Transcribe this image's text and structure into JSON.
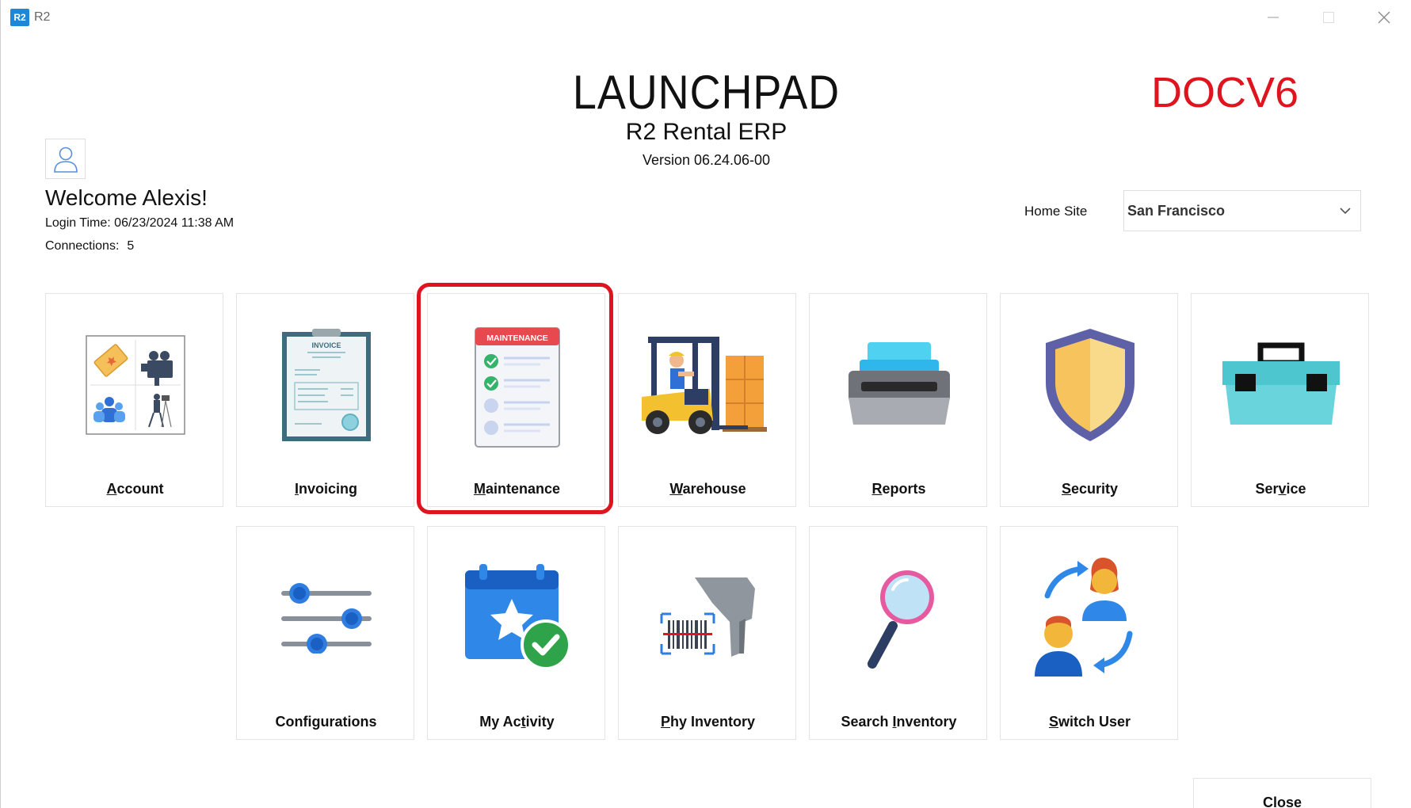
{
  "window": {
    "badge": "R2",
    "title": "R2"
  },
  "header": {
    "title": "LAUNCHPAD",
    "product": "R2 Rental ERP",
    "version": "Version 06.24.06-00",
    "environment": "DOCV6",
    "environment_color": "#e0141e"
  },
  "user": {
    "welcome": "Welcome Alexis!",
    "login_time_label": "Login Time:",
    "login_time": "06/23/2024 11:38 AM",
    "connections_label": "Connections:",
    "connections": "5"
  },
  "home_site": {
    "label": "Home Site",
    "value": "San Francisco"
  },
  "tiles_row1": [
    {
      "label": "Account",
      "accel": "A",
      "rest": "ccount",
      "icon": "account-icon"
    },
    {
      "label": "Invoicing",
      "accel": "I",
      "rest": "nvoicing",
      "icon": "invoice-icon"
    },
    {
      "label": "Maintenance",
      "accel": "M",
      "rest": "aintenance",
      "icon": "maintenance-checklist-icon",
      "badge": "MAINTENANCE"
    },
    {
      "label": "Warehouse",
      "accel": "W",
      "rest": "arehouse",
      "icon": "forklift-icon"
    },
    {
      "label": "Reports",
      "accel": "R",
      "rest": "eports",
      "icon": "printer-icon"
    },
    {
      "label": "Security",
      "accel": "S",
      "rest": "ecurity",
      "icon": "shield-icon"
    },
    {
      "label": "Service",
      "pre": "Ser",
      "accel": "v",
      "rest": "ice",
      "icon": "toolbox-icon"
    }
  ],
  "tiles_row2": [
    {
      "label": "Configurations",
      "icon": "sliders-icon"
    },
    {
      "label": "My Activity",
      "pre": "My Ac",
      "accel": "t",
      "rest": "ivity",
      "icon": "calendar-check-icon"
    },
    {
      "label": "Phy Inventory",
      "accel": "P",
      "rest": "hy Inventory",
      "icon": "barcode-scanner-icon"
    },
    {
      "label": "Search Inventory",
      "pre": "Search ",
      "accel": "I",
      "rest": "nventory",
      "icon": "magnifier-icon"
    },
    {
      "label": "Switch User",
      "accel": "S",
      "rest": "witch User",
      "icon": "switch-user-icon"
    }
  ],
  "invoice_header": "INVOICE",
  "close_button": {
    "accel": "C",
    "rest": "lose"
  }
}
